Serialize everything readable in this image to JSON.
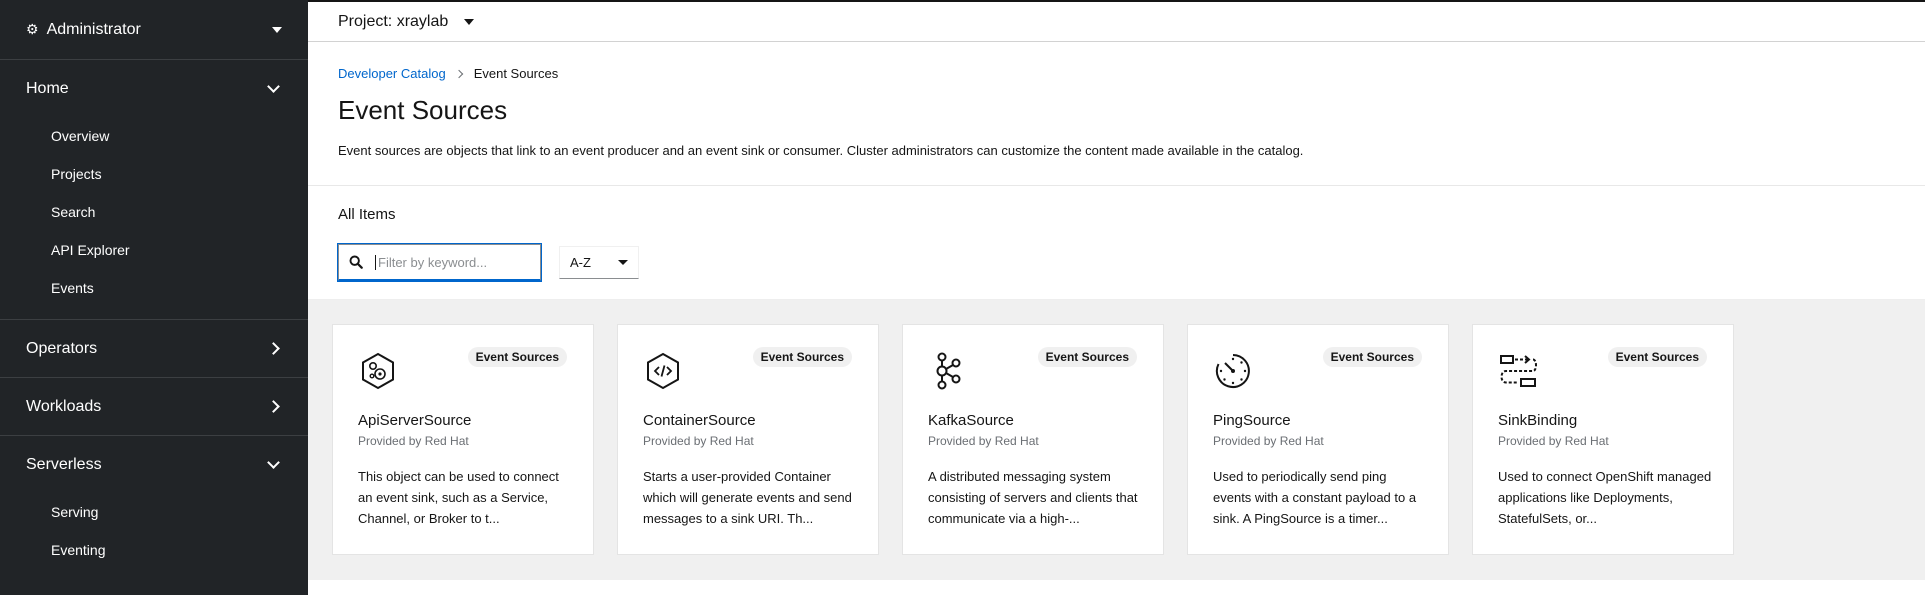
{
  "perspective": {
    "title": "Administrator",
    "icon": "gears-icon"
  },
  "nav": {
    "home": {
      "label": "Home",
      "items": [
        "Overview",
        "Projects",
        "Search",
        "API Explorer",
        "Events"
      ]
    },
    "operators": {
      "label": "Operators"
    },
    "workloads": {
      "label": "Workloads"
    },
    "serverless": {
      "label": "Serverless",
      "items": [
        "Serving",
        "Eventing"
      ]
    }
  },
  "project": {
    "label": "Project: xraylab"
  },
  "breadcrumb": {
    "parent": "Developer Catalog",
    "current": "Event Sources"
  },
  "page": {
    "title": "Event Sources",
    "description": "Event sources are objects that link to an event producer and an event sink or consumer. Cluster administrators can customize the content made available in the catalog."
  },
  "filter": {
    "heading": "All Items",
    "placeholder": "Filter by keyword...",
    "sort_value": "A-Z"
  },
  "cards": [
    {
      "title": "ApiServerSource",
      "provider": "Provided by Red Hat",
      "badge": "Event Sources",
      "icon": "apiserver-icon",
      "description": "This object can be used to connect an event sink, such as a Service, Channel, or Broker to t..."
    },
    {
      "title": "ContainerSource",
      "provider": "Provided by Red Hat",
      "badge": "Event Sources",
      "icon": "container-icon",
      "description": "Starts a user-provided Container which will generate events and send messages to a sink URI. Th..."
    },
    {
      "title": "KafkaSource",
      "provider": "Provided by Red Hat",
      "badge": "Event Sources",
      "icon": "kafka-icon",
      "description": "A distributed messaging system consisting of servers and clients that communicate via a high-..."
    },
    {
      "title": "PingSource",
      "provider": "Provided by Red Hat",
      "badge": "Event Sources",
      "icon": "ping-icon",
      "description": "Used to periodically send ping events with a constant payload to a sink. A PingSource is a timer..."
    },
    {
      "title": "SinkBinding",
      "provider": "Provided by Red Hat",
      "badge": "Event Sources",
      "icon": "sinkbinding-icon",
      "description": "Used to connect OpenShift managed applications like Deployments, StatefulSets, or..."
    }
  ],
  "colors": {
    "sidebar_bg": "#212427",
    "link": "#0066cc",
    "catalog_bg": "#f0f0f0"
  }
}
